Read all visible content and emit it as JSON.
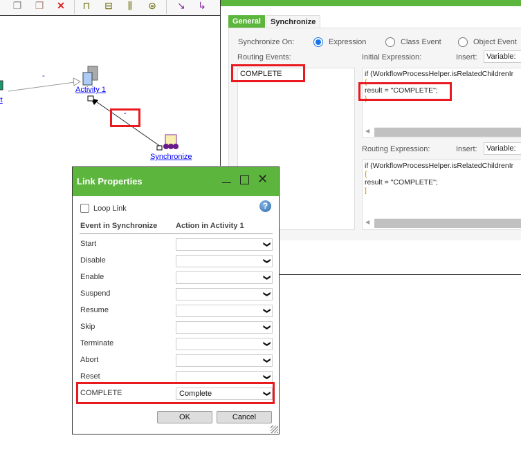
{
  "toolbar": {
    "icons": [
      "copy-icon",
      "paste-icon",
      "delete-icon",
      "align-top-icon",
      "align-middle-icon",
      "align-vertical-icon",
      "align-center-icon",
      "arrow-diagonal-icon",
      "arrow-bend-icon"
    ]
  },
  "canvas": {
    "start_label": "rt",
    "activity_label": "Activity 1",
    "synchronize_label": "Synchronize",
    "link1_label": "-",
    "link2_label": "-"
  },
  "properties": {
    "tabs": [
      {
        "label": "General",
        "active": false
      },
      {
        "label": "Synchronize",
        "active": true
      }
    ],
    "synchronize_on_label": "Synchronize On:",
    "options": [
      {
        "label": "Expression",
        "selected": true
      },
      {
        "label": "Class Event",
        "selected": false
      },
      {
        "label": "Object Event",
        "selected": false
      }
    ],
    "routing_events_label": "Routing Events:",
    "routing_events": [
      "COMPLETE"
    ],
    "initial_expression_label": "Initial Expression:",
    "insert_label": "Insert:",
    "insert_value": "Variable:",
    "initial_expression_lines": [
      "if (WorkflowProcessHelper.isRelatedChildrenIr",
      "{",
      "result = \"COMPLETE\";",
      "}"
    ],
    "routing_expression_label": "Routing Expression:",
    "routing_expression_lines": [
      "if (WorkflowProcessHelper.isRelatedChildrenIr",
      "{",
      "result = \"COMPLETE\";",
      "]"
    ]
  },
  "dialog": {
    "title": "Link Properties",
    "loop_link_label": "Loop Link",
    "loop_link_checked": false,
    "col_event": "Event in Synchronize",
    "col_action": "Action in Activity 1",
    "rows": [
      {
        "event": "Start",
        "action": ""
      },
      {
        "event": "Disable",
        "action": ""
      },
      {
        "event": "Enable",
        "action": ""
      },
      {
        "event": "Suspend",
        "action": ""
      },
      {
        "event": "Resume",
        "action": ""
      },
      {
        "event": "Skip",
        "action": ""
      },
      {
        "event": "Terminate",
        "action": ""
      },
      {
        "event": "Abort",
        "action": ""
      },
      {
        "event": "Reset",
        "action": ""
      },
      {
        "event": "COMPLETE",
        "action": "Complete"
      }
    ],
    "ok_label": "OK",
    "cancel_label": "Cancel"
  },
  "colors": {
    "brand_green": "#5cb53c",
    "highlight_red": "#e8191f",
    "link_blue": "#0000ff"
  }
}
